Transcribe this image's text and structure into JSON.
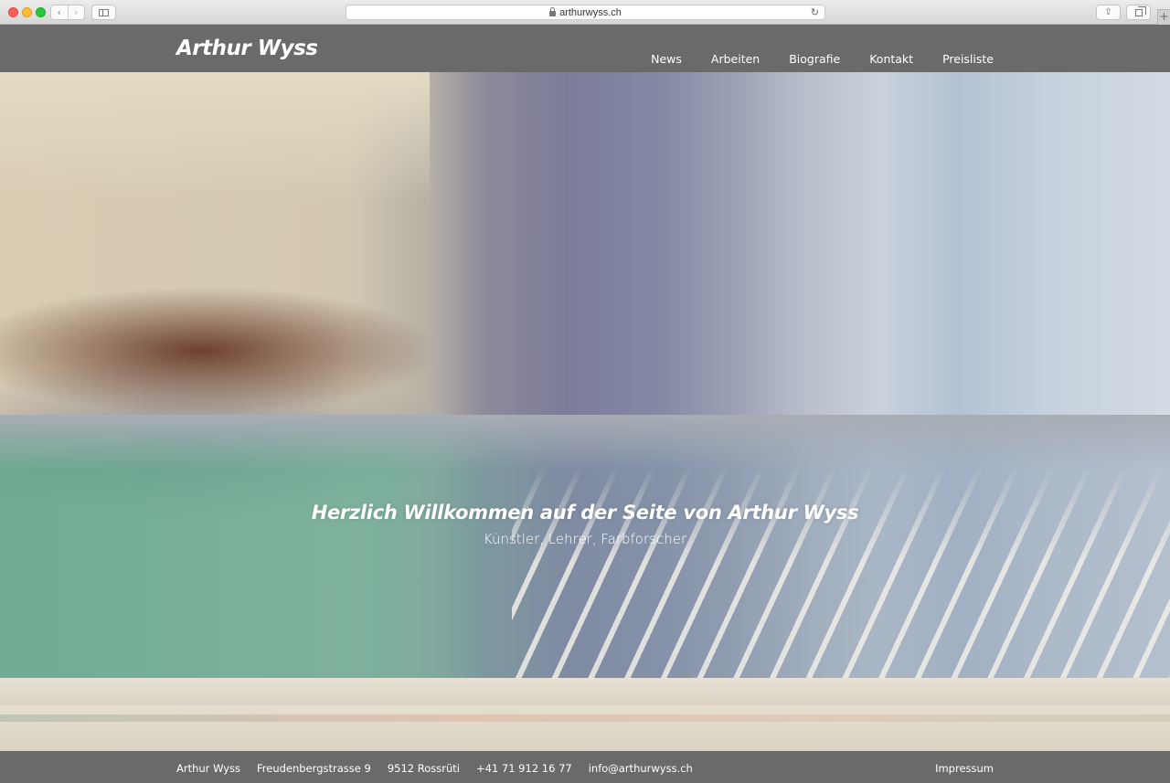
{
  "browser": {
    "url": "arthurwyss.ch",
    "back_glyph": "‹",
    "forward_glyph": "›",
    "reload_glyph": "↻",
    "share_glyph": "⇪",
    "new_tab_glyph": "+"
  },
  "header": {
    "logo": "Arthur Wyss",
    "nav": [
      "News",
      "Arbeiten",
      "Biografie",
      "Kontakt",
      "Preisliste"
    ]
  },
  "hero": {
    "title": "Herzlich Willkommen auf der Seite von Arthur Wyss",
    "subtitle": "Künstler, Lehrer, Farbforscher"
  },
  "footer": {
    "name": "Arthur Wyss",
    "street": "Freudenbergstrasse 9",
    "city": "9512 Rossrüti",
    "phone": "+41 71 912 16 77",
    "email": "info@arthurwyss.ch",
    "impressum": "Impressum"
  },
  "colors": {
    "header_bg": "#6a6a6a",
    "footer_bg": "#6a6a6a",
    "text": "#ffffff"
  }
}
